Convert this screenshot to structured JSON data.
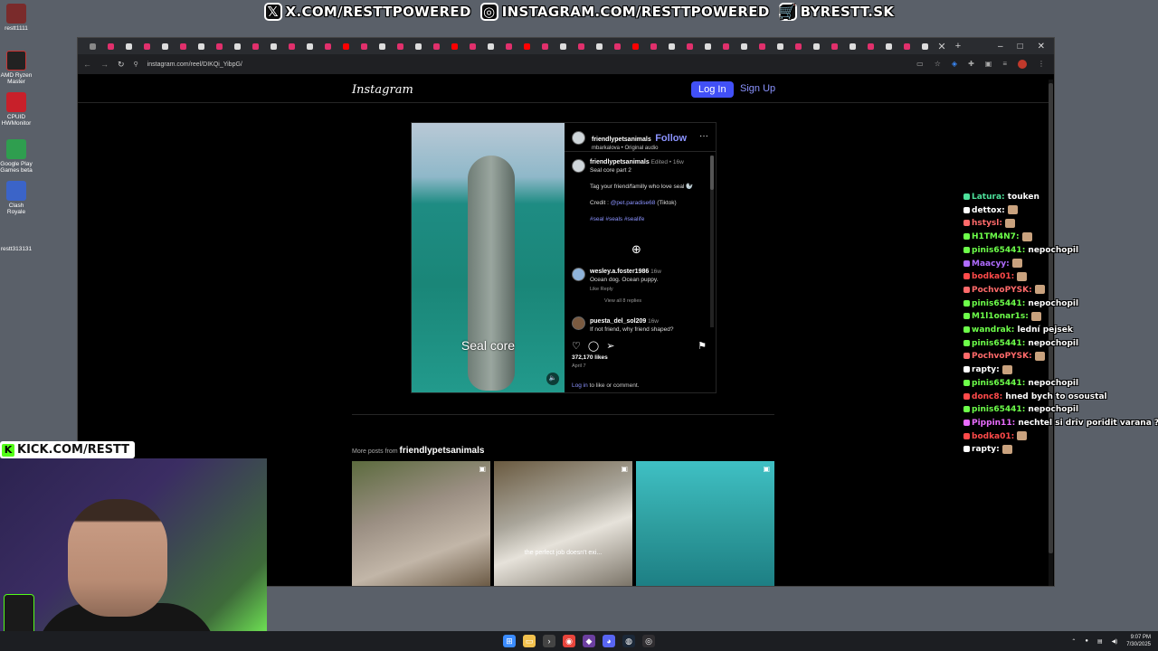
{
  "banner": {
    "items": [
      {
        "icon": "x-logo-icon",
        "glyph": "𝕏",
        "text": "X.COM/RESTTPOWERED"
      },
      {
        "icon": "instagram-logo-icon",
        "glyph": "◎",
        "text": "INSTAGRAM.COM/RESTTPOWERED"
      },
      {
        "icon": "cart-icon",
        "glyph": "🛒",
        "text": "BYRESTT.SK"
      }
    ]
  },
  "desktop": {
    "icons": [
      {
        "label": "restt1111",
        "color": "#7a2b2b"
      },
      {
        "label": "AMD Ryzen Master",
        "color": "#222"
      },
      {
        "label": "CPUID HWMonitor",
        "color": "#c8202a"
      },
      {
        "label": "Google Play Games beta",
        "color": "#2f9e4f"
      },
      {
        "label": "Clash Royale",
        "color": "#3b64c8"
      },
      {
        "label": "restt313131",
        "color": "#5a6069"
      }
    ]
  },
  "browser": {
    "url": "instagram.com/reel/DIKQi_YibpG/",
    "new_tab": "+",
    "controls": {
      "minimize": "–",
      "maximize": "□",
      "close": "✕"
    }
  },
  "instagram": {
    "logo": "Instagram",
    "login": "Log In",
    "signup": "Sign Up",
    "post": {
      "caption_overlay": "Seal core",
      "author": "friendlypetsanimals",
      "follow": "Follow",
      "audio": "mbarkalova • Original audio",
      "more": "···",
      "comment_author": "friendlypetsanimals",
      "edited": "Edited • 16w",
      "caption_line1": "Seal core part 2",
      "caption_line2": "Tag your friend/familly who love seal 🦭",
      "credit_label": "Credit :",
      "credit_link": "@pet.paradise68",
      "credit_suffix": "(Tiktok)",
      "hashtags": "#seal #seals #sealife",
      "comment1_user": "wesley.a.foster1986",
      "comment1_age": "16w",
      "comment1_text": "Ocean dog. Ocean puppy.",
      "comment1_actions": "Like   Reply",
      "view_replies": "View all 8 replies",
      "comment2_user": "puesta_del_sol209",
      "comment2_age": "16w",
      "comment2_text": "If not friend, why friend shaped?",
      "likes": "372,170 likes",
      "date": "April 7",
      "login_link": "Log in",
      "login_suffix": "to like or comment."
    },
    "more_posts_prefix": "More posts from",
    "more_posts_user": "friendlypetsanimals",
    "grid": [
      {
        "caption": "",
        "bg": "#9b8f83"
      },
      {
        "caption": "the perfect job doesn't exi...",
        "bg": "#a9a59a"
      },
      {
        "caption": "",
        "bg": "#2f9fa0"
      }
    ]
  },
  "chat": [
    {
      "user": "Latura",
      "text": "touken",
      "color": "#4de19b"
    },
    {
      "user": "dettox",
      "text": "",
      "color": "#ffffff"
    },
    {
      "user": "hstysl",
      "text": "",
      "color": "#ff6a6a"
    },
    {
      "user": "H1TM4N7",
      "text": "",
      "color": "#6dff4a"
    },
    {
      "user": "pinis65441",
      "text": "nepochopil",
      "color": "#6dff4a"
    },
    {
      "user": "Maacyy",
      "text": "",
      "color": "#b06cff"
    },
    {
      "user": "bodka01",
      "text": "",
      "color": "#ff4a4a"
    },
    {
      "user": "PochvoPYSK",
      "text": "",
      "color": "#ff6a6a"
    },
    {
      "user": "pinis65441",
      "text": "nepochopil",
      "color": "#6dff4a"
    },
    {
      "user": "M1l1onar1s",
      "text": "",
      "color": "#6dff4a"
    },
    {
      "user": "wandrak",
      "text": "lední pejsek",
      "color": "#6dff4a"
    },
    {
      "user": "pinis65441",
      "text": "nepochopil",
      "color": "#6dff4a"
    },
    {
      "user": "PochvoPYSK",
      "text": "",
      "color": "#ff6a6a"
    },
    {
      "user": "rapty",
      "text": "",
      "color": "#ffffff"
    },
    {
      "user": "pinis65441",
      "text": "nepochopil",
      "color": "#6dff4a"
    },
    {
      "user": "donc8",
      "text": "hned bych to osoustal",
      "color": "#ff4a4a"
    },
    {
      "user": "pinis65441",
      "text": "nepochopil",
      "color": "#6dff4a"
    },
    {
      "user": "Pippin11",
      "text": "nechtel si driv poridit varana ?",
      "color": "#e96cff"
    },
    {
      "user": "bodka01",
      "text": "",
      "color": "#ff4a4a"
    },
    {
      "user": "rapty",
      "text": "",
      "color": "#ffffff"
    }
  ],
  "kick": {
    "text": "KICK.COM/RESTT"
  },
  "taskbar": {
    "apps": [
      {
        "icon": "windows-start-icon",
        "glyph": "⊞",
        "color": "#3b8cff"
      },
      {
        "icon": "file-explorer-icon",
        "glyph": "▭",
        "color": "#f2c14e"
      },
      {
        "icon": "terminal-icon",
        "glyph": "›",
        "color": "#444"
      },
      {
        "icon": "chrome-icon",
        "glyph": "◉",
        "color": "#e8453c"
      },
      {
        "icon": "app-icon",
        "glyph": "◆",
        "color": "#6b3fa0"
      },
      {
        "icon": "discord-icon",
        "glyph": "◕",
        "color": "#5865f2"
      },
      {
        "icon": "steam-icon",
        "glyph": "◍",
        "color": "#1b2838"
      },
      {
        "icon": "obs-icon",
        "glyph": "◎",
        "color": "#302e31"
      }
    ],
    "time": "9:07 PM",
    "date": "7/30/2025"
  }
}
